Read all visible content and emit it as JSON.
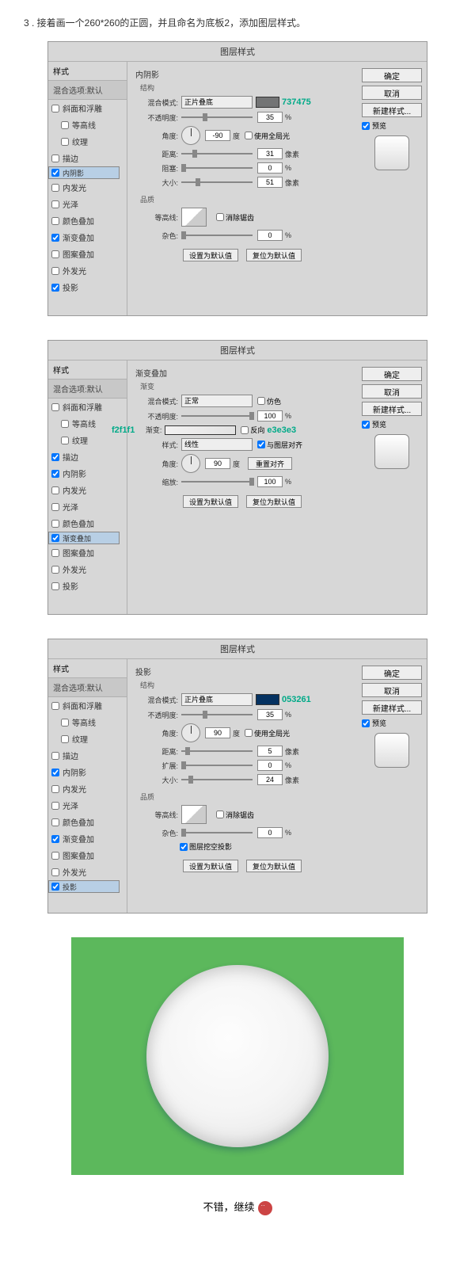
{
  "step_title": "3 . 接着画一个260*260的正圆，并且命名为底板2，添加图层样式。",
  "dialog_title": "图层样式",
  "styles_header": "样式",
  "blend_default": "混合选项:默认",
  "style_items": [
    {
      "label": "斜面和浮雕",
      "checked": false,
      "indent": false
    },
    {
      "label": "等高线",
      "checked": false,
      "indent": true
    },
    {
      "label": "纹理",
      "checked": false,
      "indent": true
    },
    {
      "label": "描边",
      "checked": false,
      "indent": false
    },
    {
      "label": "内阴影",
      "checked": true,
      "indent": false
    },
    {
      "label": "内发光",
      "checked": false,
      "indent": false
    },
    {
      "label": "光泽",
      "checked": false,
      "indent": false
    },
    {
      "label": "颜色叠加",
      "checked": false,
      "indent": false
    },
    {
      "label": "渐变叠加",
      "checked": true,
      "indent": false
    },
    {
      "label": "图案叠加",
      "checked": false,
      "indent": false
    },
    {
      "label": "外发光",
      "checked": false,
      "indent": false
    },
    {
      "label": "投影",
      "checked": true,
      "indent": false
    }
  ],
  "labels": {
    "structure": "结构",
    "blend_mode": "混合模式:",
    "opacity": "不透明度:",
    "angle": "角度:",
    "distance": "距离:",
    "choke": "阻塞:",
    "spread": "扩展:",
    "size": "大小:",
    "quality": "品质",
    "contour": "等高线:",
    "noise": "杂色:",
    "use_global": "使用全局光",
    "anti_alias": "消除锯齿",
    "deg": "度",
    "px": "像素",
    "pct": "%",
    "set_default": "设置为默认值",
    "reset_default": "复位为默认值",
    "gradient_section": "渐变叠加",
    "gradient_sub": "渐变",
    "normal": "正常",
    "multiply": "正片叠底",
    "dither": "仿色",
    "gradient": "渐变:",
    "reverse": "反向",
    "style": "样式:",
    "linear": "线性",
    "align_layer": "与图层对齐",
    "reset_align": "重置对齐",
    "scale": "缩放:",
    "shadow_section": "投影",
    "knockout": "图层挖空投影"
  },
  "right_buttons": {
    "ok": "确定",
    "cancel": "取消",
    "new_style": "新建样式...",
    "preview": "预览"
  },
  "panel1": {
    "title": "内阴影",
    "blend": "正片叠底",
    "color": "#737475",
    "hex": "737475",
    "opacity": "35",
    "angle": "-90",
    "distance": "31",
    "choke": "0",
    "size": "51",
    "noise": "0"
  },
  "panel2": {
    "opacity": "100",
    "hex_left": "f2f1f1",
    "hex_right": "e3e3e3",
    "angle": "90",
    "scale": "100"
  },
  "panel3": {
    "blend": "正片叠底",
    "color": "#053261",
    "hex": "053261",
    "opacity": "35",
    "angle": "90",
    "distance": "5",
    "spread": "0",
    "size": "24",
    "noise": "0"
  },
  "style2_items": [
    {
      "label": "斜面和浮雕",
      "checked": false,
      "indent": false
    },
    {
      "label": "等高线",
      "checked": false,
      "indent": true
    },
    {
      "label": "纹理",
      "checked": false,
      "indent": true
    },
    {
      "label": "描边",
      "checked": true,
      "indent": false
    },
    {
      "label": "内阴影",
      "checked": true,
      "indent": false
    },
    {
      "label": "内发光",
      "checked": false,
      "indent": false
    },
    {
      "label": "光泽",
      "checked": false,
      "indent": false
    },
    {
      "label": "颜色叠加",
      "checked": false,
      "indent": false
    },
    {
      "label": "渐变叠加",
      "checked": true,
      "indent": false
    },
    {
      "label": "图案叠加",
      "checked": false,
      "indent": false
    },
    {
      "label": "外发光",
      "checked": false,
      "indent": false
    },
    {
      "label": "投影",
      "checked": false,
      "indent": false
    }
  ],
  "footer_text": "不错，继续"
}
